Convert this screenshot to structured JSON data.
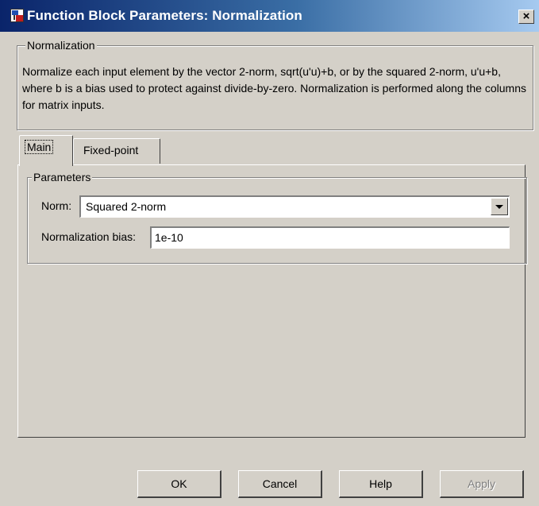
{
  "window": {
    "title": "Function Block Parameters: Normalization",
    "close_glyph": "×",
    "icon": "simulink-block-icon"
  },
  "normalization_group": {
    "legend": "Normalization",
    "description": "Normalize each input element by the vector 2-norm, sqrt(u'u)+b, or by the squared 2-norm, u'u+b, where b is a bias used to protect against divide-by-zero.  Normalization is performed along the columns for matrix inputs."
  },
  "tabs": [
    {
      "label": "Main",
      "selected": true
    },
    {
      "label": "Fixed-point",
      "selected": false
    }
  ],
  "parameters_group": {
    "legend": "Parameters",
    "norm": {
      "label": "Norm:",
      "selected": "Squared 2-norm"
    },
    "bias": {
      "label": "Normalization bias:",
      "value": "1e-10"
    }
  },
  "buttons": {
    "ok": "OK",
    "cancel": "Cancel",
    "help": "Help",
    "apply": "Apply"
  },
  "colors": {
    "face": "#d4d0c8",
    "title_start": "#0a246a",
    "title_end": "#a6caf0"
  }
}
